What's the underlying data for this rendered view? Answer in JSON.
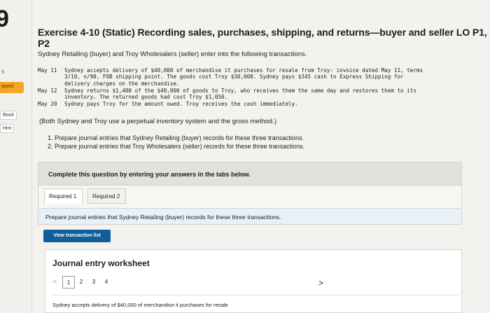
{
  "sidebar": {
    "step_number": "9",
    "nav_dot": "s",
    "skipped_label": "ipped",
    "ebook_label": "Book",
    "hint_label": "Hint"
  },
  "exercise": {
    "title": "Exercise 4-10 (Static) Recording sales, purchases, shipping, and returns—buyer and seller LO P1, P2",
    "intro": "Sydney Retailing (buyer) and Troy Wholesalers (seller) enter into the following transactions.",
    "transactions": [
      {
        "date": "May 11",
        "lines": [
          "Sydney accepts delivery of $40,000 of merchandise it purchases for resale from Troy: invoice dated May 11, terms",
          "3/10, n/90, FOB shipping point. The goods cost Troy $30,000. Sydney pays $345 cash to Express Shipping for",
          "delivery charges on the merchandise."
        ]
      },
      {
        "date": "May 12",
        "lines": [
          "Sydney returns $1,400 of the $40,000 of goods to Troy, who receives them the same day and restores them to its",
          "inventory. The returned goods had cost Troy $1,050."
        ]
      },
      {
        "date": "May 20",
        "lines": [
          "Sydney pays Troy for the amount owed. Troy receives the cash immediately."
        ]
      }
    ],
    "note": "(Both Sydney and Troy use a perpetual inventory system and the gross method.)",
    "tasks": [
      "1. Prepare journal entries that Sydney Retailing (buyer) records for these three transactions.",
      "2. Prepare journal entries that Troy Wholesalers (seller) records for these three transactions."
    ]
  },
  "instructions": {
    "complete_text": "Complete this question by entering your answers in the tabs below."
  },
  "tabs": [
    {
      "label": "Required 1",
      "active": true
    },
    {
      "label": "Required 2",
      "active": false
    }
  ],
  "prepare_text": "Prepare journal entries that Sydney Retailing (buyer) records for these three transactions.",
  "view_button": "View transaction list",
  "worksheet": {
    "title": "Journal entry worksheet",
    "pages": [
      "1",
      "2",
      "3",
      "4"
    ],
    "active_page": "1",
    "prev_arrow": "<",
    "next_arrow": ">",
    "description": "Sydney accepts delivery of $40,000 of merchandise it purchases for resale"
  },
  "colors": {
    "primary_button": "#0f5f9c",
    "skipped_tag": "#f5a623",
    "prepare_bar": "#e8f1f8"
  }
}
